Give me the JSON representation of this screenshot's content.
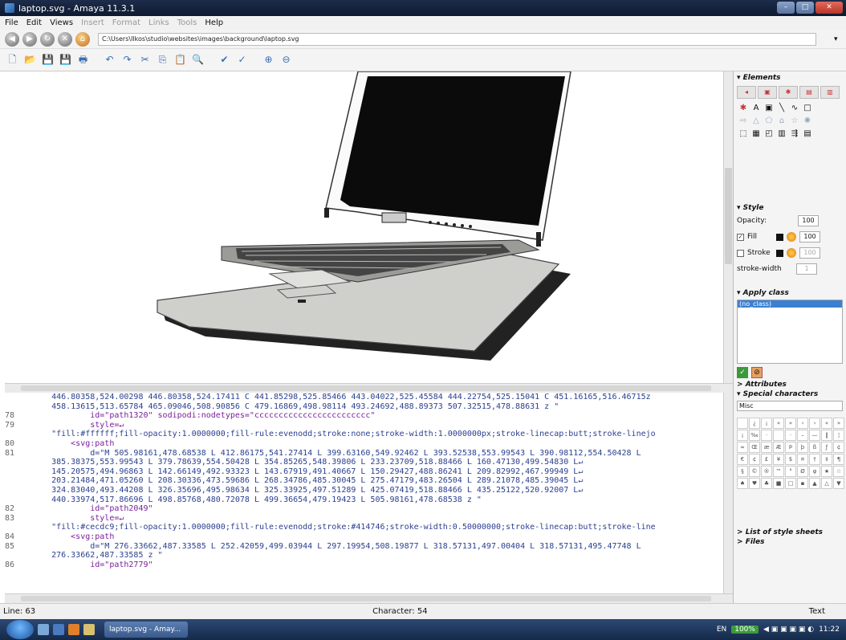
{
  "window": {
    "title": "laptop.svg - Amaya 11.3.1"
  },
  "menu": [
    "File",
    "Edit",
    "Views",
    "Insert",
    "Format",
    "Links",
    "Tools",
    "Help"
  ],
  "menu_disabled": [
    "Insert",
    "Format",
    "Links",
    "Tools"
  ],
  "address": {
    "url": "C:\\Users\\Ilkos\\studio\\websites\\images\\background\\laptop.svg"
  },
  "source_lines": [
    {
      "n": "",
      "t": "    446.80358,524.00298 446.80358,524.17411 C 441.85298,525.85466 443.04022,525.45584 444.22754,525.15041 C 451.16165,516.46715z",
      "c": "code"
    },
    {
      "n": "",
      "t": "    458.13615,513.65784 465.09046,508.90856 C 479.16869,498.98114 493.24692,488.89373 507.32515,478.88631 z \"",
      "c": "code"
    },
    {
      "n": "78",
      "t": "            id=\"path1320\" sodipodi:nodetypes=\"cccccccccccccccccccccccc\"",
      "c": "code attr"
    },
    {
      "n": "79",
      "t": "            style=↵",
      "c": "code attr"
    },
    {
      "n": "",
      "t": "    \"fill:#ffffff;fill-opacity:1.0000000;fill-rule:evenodd;stroke:none;stroke-width:1.0000000px;stroke-linecap:butt;stroke-linejo",
      "c": "code"
    },
    {
      "n": "80",
      "t": "        <svg:path",
      "c": "code attr"
    },
    {
      "n": "81",
      "t": "            d=\"M 505.98161,478.68538 L 412.86175,541.27414 L 399.63160,549.92462 L 393.52538,553.99543 L 390.98112,554.50428 L",
      "c": "code"
    },
    {
      "n": "",
      "t": "    385.38375,553.99543 L 379.78639,554.50428 L 354.85265,548.39806 L 233.23709,518.88466 L 160.47130,499.54830 L↵",
      "c": "code"
    },
    {
      "n": "",
      "t": "    145.20575,494.96863 L 142.66149,492.93323 L 143.67919,491.40667 L 150.29427,488.86241 L 209.82992,467.99949 L↵",
      "c": "code"
    },
    {
      "n": "",
      "t": "    203.21484,471.05260 L 208.30336,473.59686 L 268.34786,485.30045 L 275.47179,483.26504 L 289.21078,485.39045 L↵",
      "c": "code"
    },
    {
      "n": "",
      "t": "    324.83040,493.44208 L 326.35696,495.98634 L 325.33925,497.51289 L 425.07419,518.88466 L 435.25122,520.92007 L↵",
      "c": "code"
    },
    {
      "n": "",
      "t": "    440.33974,517.86696 L 498.85768,480.72078 L 499.36654,479.19423 L 505.98161,478.68538 z \"",
      "c": "code"
    },
    {
      "n": "82",
      "t": "            id=\"path2049\"",
      "c": "code attr"
    },
    {
      "n": "83",
      "t": "            style=↵",
      "c": "code attr"
    },
    {
      "n": "",
      "t": "    \"fill:#cecdc9;fill-opacity:1.0000000;fill-rule:evenodd;stroke:#414746;stroke-width:0.50000000;stroke-linecap:butt;stroke-line",
      "c": "code"
    },
    {
      "n": "84",
      "t": "        <svg:path",
      "c": "code attr"
    },
    {
      "n": "85",
      "t": "            d=\"M 276.33662,487.33585 L 252.42059,499.03944 L 297.19954,508.19877 L 318.57131,497.00404 L 318.57131,495.47748 L",
      "c": "code"
    },
    {
      "n": "",
      "t": "    276.33662,487.33585 z \"",
      "c": "code"
    },
    {
      "n": "86",
      "t": "            id=\"path2779\"",
      "c": "code attr"
    }
  ],
  "panel": {
    "elements_title": "Elements",
    "style_title": "Style",
    "opacity_label": "Opacity:",
    "opacity_value": "100",
    "fill_label": "Fill",
    "fill_value": "100",
    "stroke_label": "Stroke",
    "stroke_value": "100",
    "stroke_width_label": "stroke-width",
    "stroke_width_value": "1",
    "apply_class_title": "Apply class",
    "apply_class_item": "(no_class)",
    "attributes_title": "Attributes",
    "special_chars_title": "Special characters",
    "special_chars_select": "Misc",
    "style_sheets_title": "List of style sheets",
    "files_title": "Files"
  },
  "status": {
    "line": "Line: 63",
    "character": "Character: 54",
    "mode": "Text"
  },
  "taskbar": {
    "item": "laptop.svg - Amay...",
    "lang": "EN",
    "zoom": "100%",
    "time": "11:22"
  },
  "icons": [
    "back-icon",
    "forward-icon",
    "reload-icon",
    "stop-icon",
    "home-icon"
  ]
}
